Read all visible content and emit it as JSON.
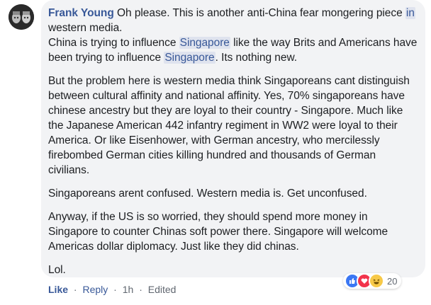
{
  "comment": {
    "author": "Frank Young",
    "paragraphs": {
      "p1_a": " Oh please. This is another anti-China fear mongering piece ",
      "p1_link1": "in",
      "p1_b": " western media.",
      "p1_c": "China is trying to influence ",
      "p1_link2": "Singapore",
      "p1_d": " like the way Brits and Americans have been trying to influence ",
      "p1_link3": "Singapore",
      "p1_e": ". Its nothing new.",
      "p2": "But the problem here is western media think Singaporeans cant distinguish between cultural affinity and national affinity. Yes, 70% singaporeans have chinese ancestry but they are loyal to their country - Singapore. Much like the Japanese American 442 infantry regiment in WW2 were loyal to their America. Or like Eisenhower, with German ancestry, who mercilessly firebombed German cities killing hundred and thousands of German civilians.",
      "p3": "Singaporeans arent confused. Western media is. Get unconfused.",
      "p4": "Anyway, if the US is so worried, they should spend more money in Singapore to counter Chinas soft power there. Singapore will welcome Americas dollar diplomacy. Just like they did chinas.",
      "p5": "Lol."
    }
  },
  "actions": {
    "like": "Like",
    "reply": "Reply",
    "time": "1h",
    "edited": "Edited",
    "separator": "·"
  },
  "reactions": {
    "count": "20",
    "icons": [
      "like-reaction-icon",
      "love-reaction-icon",
      "haha-reaction-icon"
    ]
  },
  "colors": {
    "link": "#385898",
    "bubble": "#f2f3f5",
    "text": "#1c1e21",
    "meta": "#606770"
  }
}
